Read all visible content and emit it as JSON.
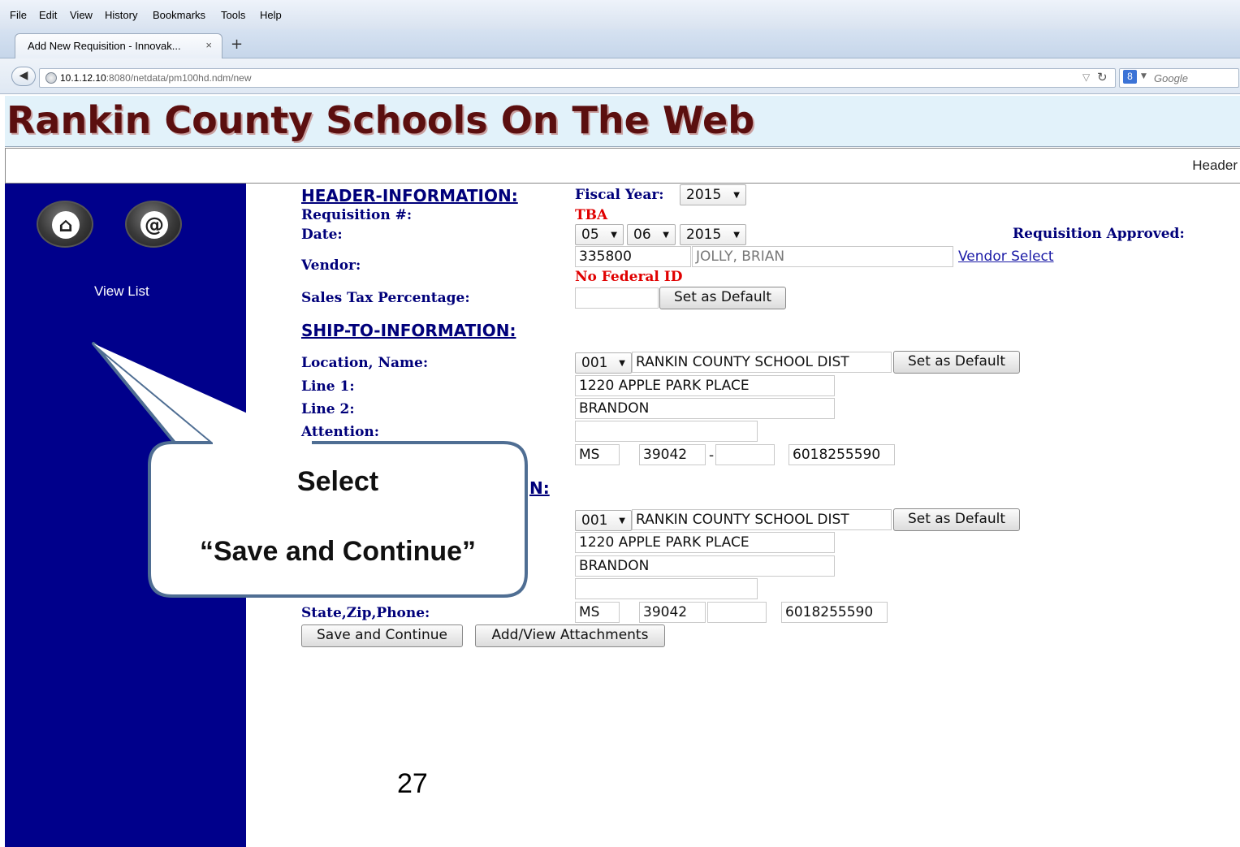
{
  "browser": {
    "menu": [
      "File",
      "Edit",
      "View",
      "History",
      "Bookmarks",
      "Tools",
      "Help"
    ],
    "tab_title": "Add New Requisition - Innovak...",
    "tab_close": "×",
    "new_tab": "+",
    "url_host": "10.1.12.10",
    "url_rest": ":8080/netdata/pm100hd.ndm/new",
    "search_placeholder": "Google",
    "search_engine_letter": "8"
  },
  "banner": {
    "title": "Rankin County Schools On The Web",
    "header_label": "Header"
  },
  "sidebar": {
    "view_list": "View List",
    "home_glyph": "⌂",
    "at_glyph": "@"
  },
  "form": {
    "header_section": "HEADER-INFORMATION:",
    "fiscal_year_label": "Fiscal Year:",
    "fiscal_year": "2015",
    "requisition_label": "Requisition #:",
    "requisition_value": "TBA",
    "date_label": "Date:",
    "date_month": "05",
    "date_day": "06",
    "date_year": "2015",
    "requisition_approved": "Requisition Approved:",
    "vendor_label": "Vendor:",
    "vendor_id": "335800",
    "vendor_name": "JOLLY, BRIAN",
    "vendor_select": "Vendor Select",
    "no_federal_id": "No Federal ID",
    "sales_tax_label": "Sales Tax Percentage:",
    "sales_tax_value": "",
    "set_default": "Set as Default",
    "ship_section": "SHIP-TO-INFORMATION:",
    "ship_location_label": "Location, Name:",
    "ship_location": "001",
    "ship_name": "RANKIN COUNTY SCHOOL DIST",
    "ship_line1_label": "Line 1:",
    "ship_line1": "1220 APPLE PARK PLACE",
    "ship_line2_label": "Line 2:",
    "ship_line2": "BRANDON",
    "ship_attention_label": "Attention:",
    "ship_state": "MS",
    "ship_zip": "39042",
    "ship_zip_sep": "-",
    "ship_zip4": "",
    "ship_phone": "6018255590",
    "bill_section_tail": "N:",
    "bill_location": "001",
    "bill_name": "RANKIN COUNTY SCHOOL DIST",
    "bill_line1": "1220 APPLE PARK PLACE",
    "bill_line2": "BRANDON",
    "bill_attention": "",
    "bill_state_label": "State,Zip,Phone:",
    "bill_state": "MS",
    "bill_zip": "39042",
    "bill_zip4": "",
    "bill_phone": "6018255590",
    "save_continue": "Save and Continue",
    "attachments": "Add/View Attachments"
  },
  "callout": {
    "line1": "Select",
    "line2": "“Save and Continue”"
  },
  "page_number": "27"
}
